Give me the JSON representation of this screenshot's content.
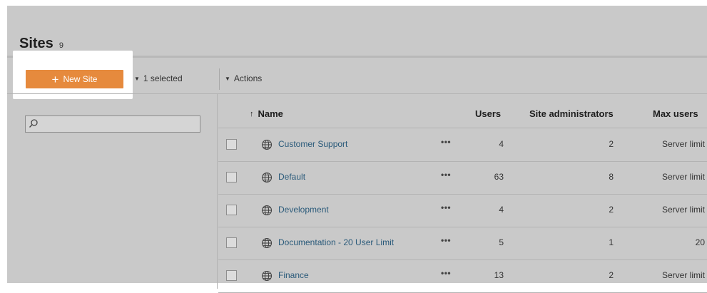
{
  "page": {
    "title": "Sites",
    "count": "9"
  },
  "toolbar": {
    "new_site_label": "New Site",
    "selected_label": "1 selected",
    "actions_label": "Actions"
  },
  "search": {
    "value": "",
    "placeholder": ""
  },
  "table": {
    "headers": {
      "name": "Name",
      "users": "Users",
      "site_administrators": "Site administrators",
      "max_users": "Max users"
    },
    "sort": {
      "column": "name",
      "direction": "ascending"
    },
    "more_glyph": "•••",
    "rows": [
      {
        "name": "Customer Support",
        "users": "4",
        "site_administrators": "2",
        "max_users": "Server limit",
        "checked": false
      },
      {
        "name": "Default",
        "users": "63",
        "site_administrators": "8",
        "max_users": "Server limit",
        "checked": false
      },
      {
        "name": "Development",
        "users": "4",
        "site_administrators": "2",
        "max_users": "Server limit",
        "checked": false
      },
      {
        "name": "Documentation - 20 User Limit",
        "users": "5",
        "site_administrators": "1",
        "max_users": "20",
        "checked": false
      },
      {
        "name": "Finance",
        "users": "13",
        "site_administrators": "2",
        "max_users": "Server limit",
        "checked": false
      }
    ]
  },
  "icons": {
    "plus": "plus-icon",
    "caret": "caret-down-icon",
    "search": "search-icon",
    "globe": "globe-icon",
    "sort": "sort-arrow-icon",
    "more": "more-icon"
  },
  "colors": {
    "background": "#c9c9c9",
    "accent": "#e68a3d",
    "link": "#2a5a7a",
    "highlight": "#ffffff"
  }
}
